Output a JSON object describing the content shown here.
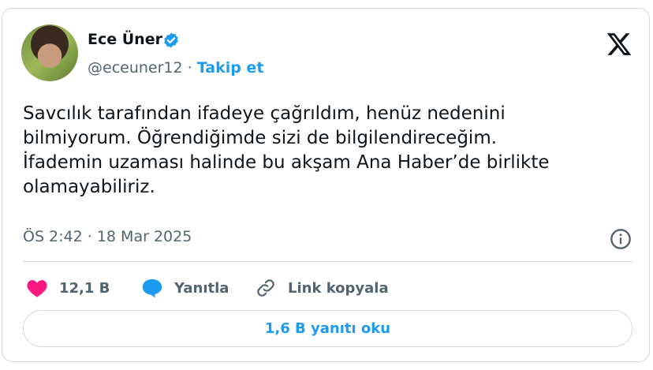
{
  "author": {
    "name": "Ece Üner",
    "handle": "@eceuner12",
    "separator": "·",
    "follow_label": "Takip et"
  },
  "tweet": {
    "lines": [
      "Savcılık tarafından ifadeye çağrıldım, henüz nedenini",
      "bilmiyorum. Öğrendiğimde sizi de bilgilendireceğim.",
      "İfademin uzaması halinde bu akşam Ana Haber’de birlikte",
      "olamayabiliriz."
    ],
    "timestamp": "ÖS 2:42 · 18 Mar 2025"
  },
  "actions": {
    "like_count": "12,1 B",
    "reply_label": "Yanıtla",
    "copy_link_label": "Link kopyala"
  },
  "replies_button_label": "1,6 B yanıtı oku",
  "icons": {
    "verified": "verified-badge-icon",
    "platform": "x-logo-icon",
    "info": "info-icon",
    "like": "heart-icon",
    "reply": "speech-bubble-icon",
    "copy_link": "link-icon"
  },
  "colors": {
    "accent": "#1d9bf0",
    "like": "#f91880",
    "text": "#0f1419",
    "muted": "#536471"
  }
}
